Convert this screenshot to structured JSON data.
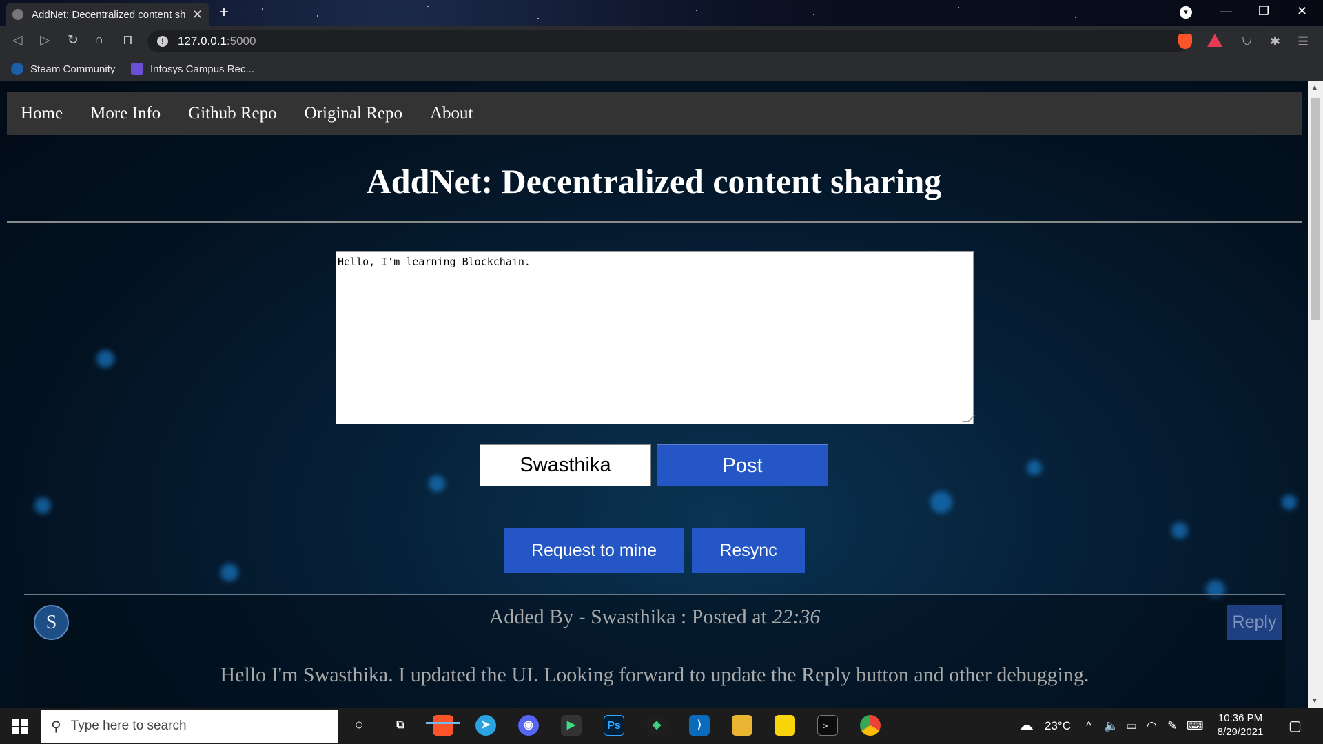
{
  "browser": {
    "tab_title": "AddNet: Decentralized content sh",
    "url_host": "127.0.0.1",
    "url_port": ":5000",
    "bookmarks": [
      "Steam Community",
      "Infosys Campus Rec..."
    ]
  },
  "nav": {
    "items": [
      "Home",
      "More Info",
      "Github Repo",
      "Original Repo",
      "About"
    ]
  },
  "page": {
    "heading": "AddNet: Decentralized content sharing",
    "content_value": "Hello, I'm learning Blockchain.",
    "author_value": "Swasthika",
    "post_label": "Post",
    "mine_label": "Request to mine",
    "resync_label": "Resync"
  },
  "post": {
    "avatar_letter": "S",
    "meta_prefix": "Added By - Swasthika : Posted at ",
    "time": "22:36",
    "reply_label": "Reply",
    "body": "Hello I'm Swasthika. I updated the UI. Looking forward to update the Reply button and other debugging."
  },
  "taskbar": {
    "search_placeholder": "Type here to search",
    "weather": "23°C",
    "time": "10:36 PM",
    "date": "8/29/2021"
  },
  "colors": {
    "button_blue": "#2457c5",
    "navbar": "#333333",
    "brave_orange": "#fb542b"
  }
}
